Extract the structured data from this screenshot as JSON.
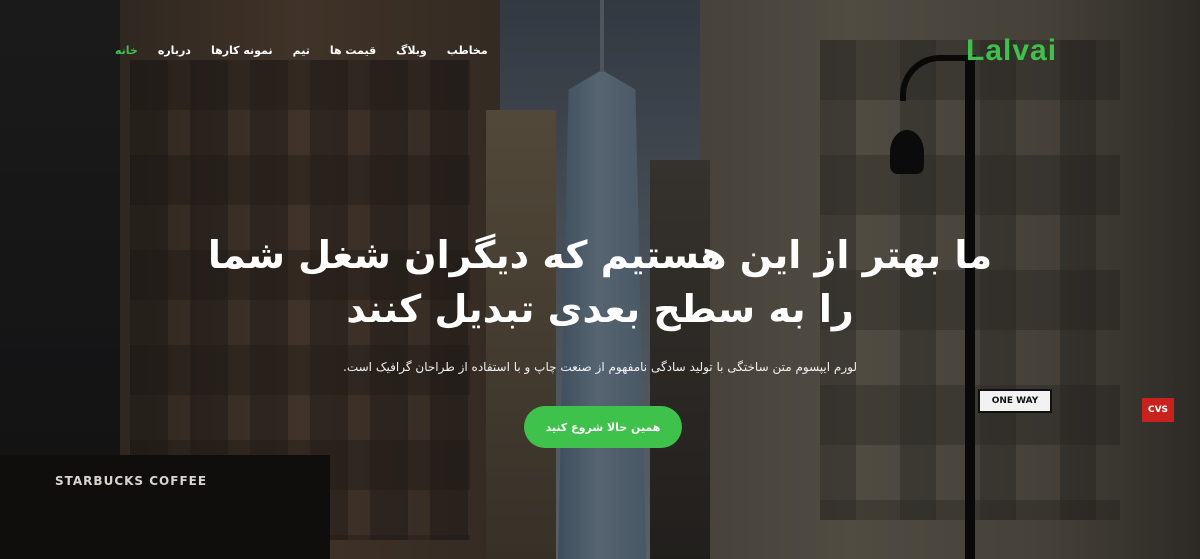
{
  "brand": {
    "logo_text": "Lalvai",
    "accent_color": "#3ec24b"
  },
  "nav": {
    "items": [
      {
        "label": "خانه",
        "active": true
      },
      {
        "label": "درباره",
        "active": false
      },
      {
        "label": "نمونه کارها",
        "active": false
      },
      {
        "label": "تیم",
        "active": false
      },
      {
        "label": "قیمت ها",
        "active": false
      },
      {
        "label": "وبلاگ",
        "active": false
      },
      {
        "label": "مخاطب",
        "active": false
      }
    ]
  },
  "hero": {
    "headline_line1": "ما بهتر از این هستیم که دیگران شغل شما",
    "headline_line2": "را به سطح بعدی تبدیل کنند",
    "subtitle": "لورم ایپسوم متن ساختگی با تولید سادگی نامفهوم از صنعت چاپ و با استفاده از طراحان گرافیک است.",
    "cta_label": "همین حالا شروع کنید"
  },
  "background": {
    "store_sign": "STARBUCKS COFFEE",
    "street_sign": "ONE WAY",
    "shop_sign": "CVS"
  }
}
